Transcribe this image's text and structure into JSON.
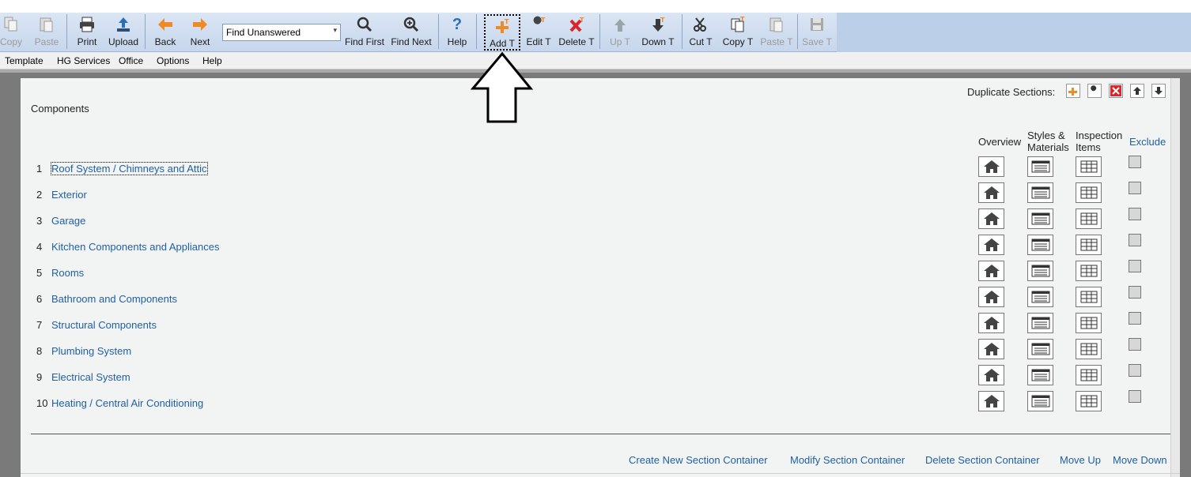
{
  "toolbar": {
    "copy": "Copy",
    "paste": "Paste",
    "print": "Print",
    "upload": "Upload",
    "back": "Back",
    "next": "Next",
    "find_select_value": "Find Unanswered",
    "find_first": "Find First",
    "find_next": "Find Next",
    "help": "Help",
    "add_t": "Add T",
    "edit_t": "Edit T",
    "delete_t": "Delete T",
    "up_t": "Up T",
    "down_t": "Down T",
    "cut_t": "Cut T",
    "copy_t": "Copy T",
    "paste_t": "Paste T",
    "save_t": "Save T"
  },
  "menu": [
    "Template",
    "HG Services",
    "Office",
    "Options",
    "Help"
  ],
  "panel": {
    "duplicate_label": "Duplicate Sections:",
    "title": "Components",
    "col_overview": "Overview",
    "col_styles_1": "Styles &",
    "col_styles_2": "Materials",
    "col_inspection_1": "Inspection",
    "col_inspection_2": "Items",
    "col_exclude": "Exclude"
  },
  "sections": [
    {
      "num": "1",
      "name": "Roof System / Chimneys and Attic"
    },
    {
      "num": "2",
      "name": "Exterior"
    },
    {
      "num": "3",
      "name": "Garage"
    },
    {
      "num": "4",
      "name": "Kitchen Components and Appliances"
    },
    {
      "num": "5",
      "name": "Rooms"
    },
    {
      "num": "6",
      "name": "Bathroom and Components"
    },
    {
      "num": "7",
      "name": "Structural Components"
    },
    {
      "num": "8",
      "name": "Plumbing System"
    },
    {
      "num": "9",
      "name": "Electrical System"
    },
    {
      "num": "10",
      "name": "Heating / Central Air Conditioning"
    }
  ],
  "bottom_links": {
    "create": "Create New Section Container",
    "modify": "Modify Section Container",
    "delete": "Delete Section Container",
    "move_up": "Move Up",
    "move_down": "Move Down"
  },
  "colors": {
    "link": "#1f5f9f",
    "accent_orange": "#f08a24",
    "accent_red": "#d9262b",
    "toolbar_blue": "#c6d6ec"
  }
}
